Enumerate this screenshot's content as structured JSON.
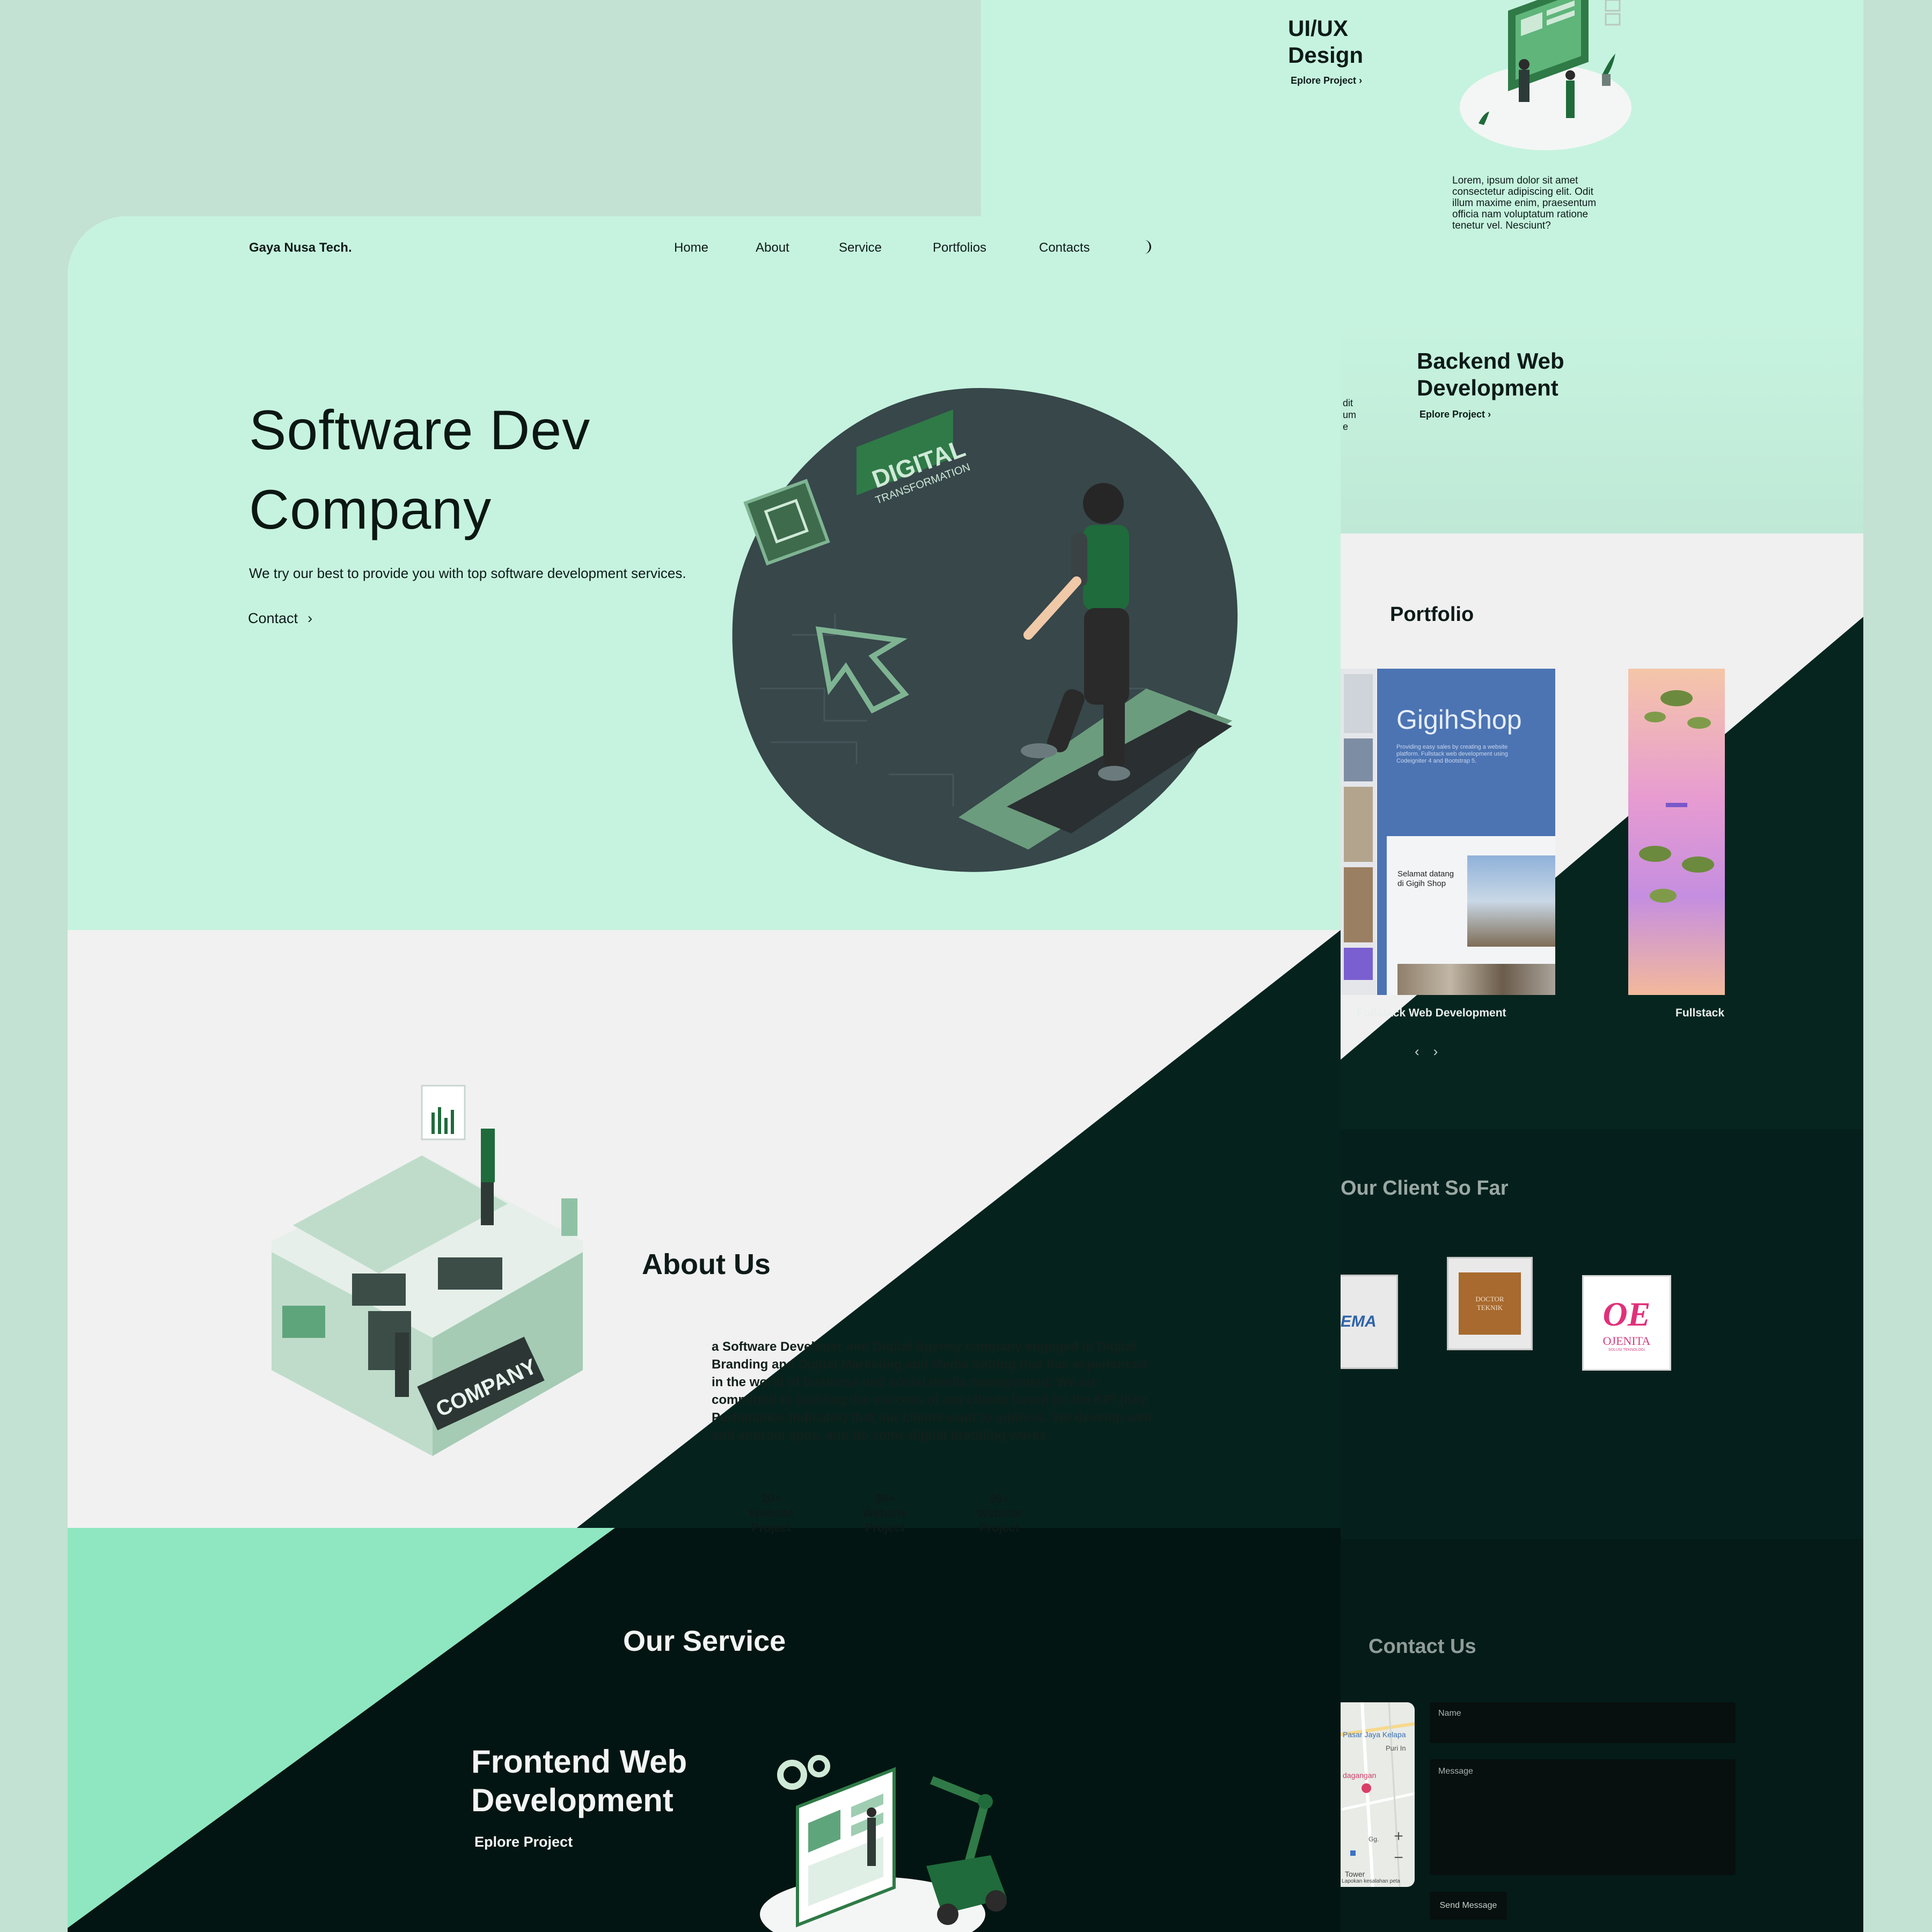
{
  "nav": {
    "logo": "Gaya Nusa Tech.",
    "items": [
      "Home",
      "About",
      "Service",
      "Portfolios",
      "Contacts"
    ]
  },
  "hero": {
    "title_line1": "Software Dev",
    "title_line2": "Company",
    "subtitle": "We try our best to provide you with top software development services.",
    "cta": "Contact",
    "illustration_sign_1": "DIGITAL",
    "illustration_sign_2": "TRANSFORMATION"
  },
  "about": {
    "title": "About Us",
    "text": "a Software Developer and Digital Agency company engaged in Digital Branding and Digital Marketing and Media Setting that has experienced in the world of business and social media management. We are committed to building the success of our clients based on the KPI (Key Perfomance Indicator) that our clients want to address. We develop web and android apps, and do some digital branding works.",
    "stats": [
      {
        "value": "20+",
        "label_1": "Website",
        "label_2": "Project"
      },
      {
        "value": "20+",
        "label_1": "Website",
        "label_2": "Project"
      },
      {
        "value": "20+",
        "label_1": "Website",
        "label_2": "Project"
      }
    ],
    "illustration_sign": "COMPANY"
  },
  "service": {
    "title": "Our Service",
    "frontend_title": "Frontend Web Development",
    "frontend_link": "Eplore Project",
    "uiux_title_1": "UI/UX",
    "uiux_title_2": "Design",
    "uiux_link": "Eplore Project",
    "uiux_text": "Lorem, ipsum dolor sit amet consectetur adipiscing elit. Odit illum maxime enim, praesentum officia nam voluptatum ratione tenetur vel. Nesciunt?",
    "backend_title_1": "Backend Web",
    "backend_title_2": "Development",
    "backend_link": "Eplore Project",
    "partial_text": [
      "dit",
      "um",
      "e"
    ]
  },
  "portfolio": {
    "title": "Portfolio",
    "shot_title": "GigihShop",
    "shot_sub": "Providing easy sales by creating a website platform. Fullstack web development using Codeigniter 4 and Bootstrap 5.",
    "shot_welcome_1": "Selamat datang",
    "shot_welcome_2": "di Gigih Shop",
    "captions": [
      "Fullstack Web Development",
      "Fullstack"
    ],
    "prev": "‹",
    "next": "›"
  },
  "clients": {
    "title": "Our Client So Far",
    "logos": [
      {
        "name": "EMA",
        "text": "EMA"
      },
      {
        "name": "DOCTOR TEKNIK",
        "text_1": "DOCTOR",
        "text_2": "TEKNIK"
      },
      {
        "name": "OJENITA",
        "mark": "OE",
        "text": "OJENITA",
        "tagline": "SOLUSI TEKNOLOGI"
      }
    ]
  },
  "contact": {
    "title": "Contact Us",
    "name_placeholder": "Name",
    "message_placeholder": "Message",
    "send_label": "Send Message",
    "map_labels": [
      "Pasar Jaya Kelapa",
      "Puri In",
      "dagangan",
      "Gg.",
      "Tower",
      "Lapokan kesalahan peta"
    ],
    "zoom_in": "+",
    "zoom_out": "−"
  },
  "colors": {
    "mint": "#c6f3df",
    "bright_mint": "#8ee7c0",
    "dark_green": "#06221d",
    "near_black": "#031512",
    "accent": "#1f6b3b"
  }
}
